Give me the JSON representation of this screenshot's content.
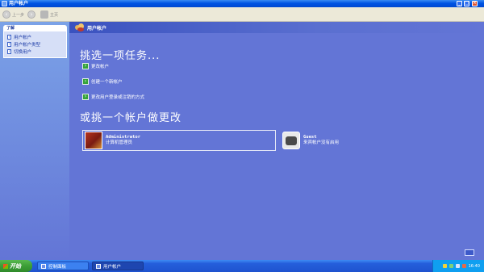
{
  "window": {
    "title": "用户帐户",
    "controls": [
      "minimize-button",
      "maximize-button",
      "close-button"
    ]
  },
  "toolbar": {
    "back_label": "上一步",
    "home_label": "主页"
  },
  "left_panel": {
    "section_title": "了解",
    "items": [
      {
        "label": "用户帐户"
      },
      {
        "label": "用户帐户类型"
      },
      {
        "label": "切换用户"
      }
    ]
  },
  "main": {
    "header_title": "用户帐户",
    "pick_task_heading": "挑选一项任务...",
    "tasks": [
      {
        "label": "更改帐户"
      },
      {
        "label": "创建一个新帐户"
      },
      {
        "label": "更改用户登录或注销的方式"
      }
    ],
    "pick_account_heading": "或挑一个帐户做更改",
    "accounts": [
      {
        "name": "Administrator",
        "description": "计算机管理员"
      },
      {
        "name": "Guest",
        "description": "来宾帐户没有启用"
      }
    ]
  },
  "taskbar": {
    "start_label": "开始",
    "windows": [
      {
        "label": "控制面板"
      },
      {
        "label": "用户帐户"
      }
    ],
    "clock": "16:40"
  }
}
